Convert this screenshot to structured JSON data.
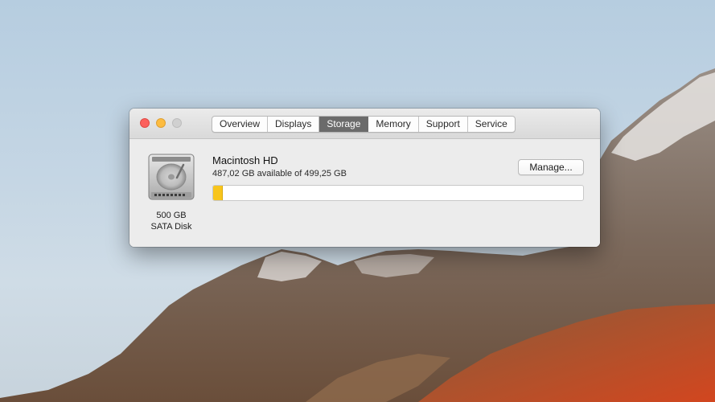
{
  "window": {
    "tabs": [
      {
        "label": "Overview"
      },
      {
        "label": "Displays"
      },
      {
        "label": "Storage"
      },
      {
        "label": "Memory"
      },
      {
        "label": "Support"
      },
      {
        "label": "Service"
      }
    ],
    "active_tab": "Storage"
  },
  "disk": {
    "icon": "hard-drive-icon",
    "capacity": "500 GB",
    "type": "SATA Disk"
  },
  "volume": {
    "name": "Macintosh HD",
    "availability": "487,02 GB available of 499,25 GB",
    "used_fraction": 0.025
  },
  "buttons": {
    "manage_label": "Manage..."
  },
  "colors": {
    "bar_used": "#f8c51c",
    "active_tab": "#6b6b6b",
    "close": "#fc605c",
    "minimize": "#fdbc40"
  }
}
